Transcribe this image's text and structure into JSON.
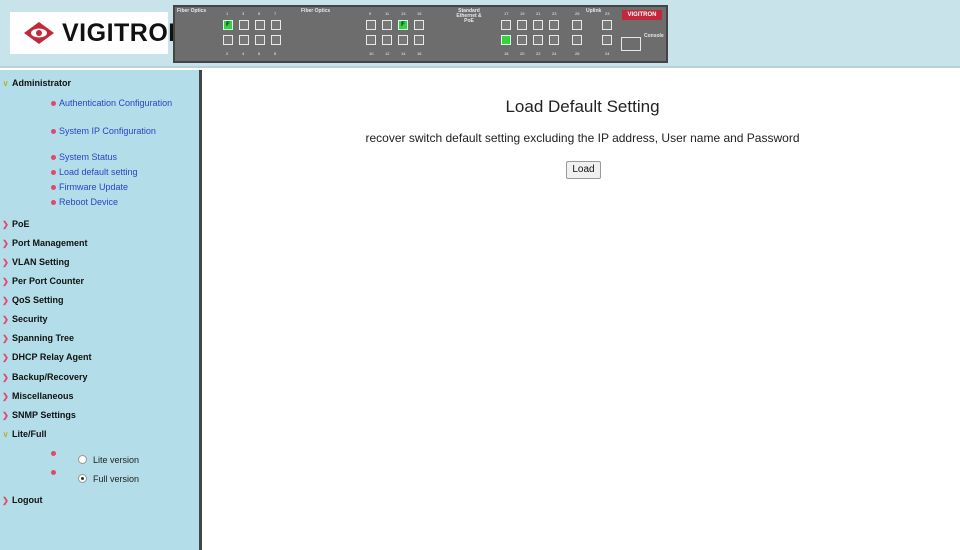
{
  "header": {
    "logo_text": "VIGITRON",
    "panel": {
      "group1_label": "Fiber Optics",
      "group2_label": "Fiber Optics",
      "group3_label": "Standard Ethernet & PoE",
      "uplink_label": "Uplink",
      "console_label": "Console",
      "panel_logo_text": "VIGITRON",
      "fiber_marker": "F",
      "top_numbers": [
        "1",
        "3",
        "5",
        "7",
        "9",
        "11",
        "13",
        "15",
        "17",
        "19",
        "21",
        "23",
        "25",
        "23"
      ],
      "bottom_numbers": [
        "2",
        "4",
        "6",
        "8",
        "10",
        "12",
        "14",
        "16",
        "18",
        "20",
        "22",
        "24",
        "26",
        "24"
      ]
    }
  },
  "sidebar": {
    "sections": [
      {
        "label": "Administrator",
        "expanded": true
      },
      {
        "label": "PoE"
      },
      {
        "label": "Port Management"
      },
      {
        "label": "VLAN Setting"
      },
      {
        "label": "Per Port Counter"
      },
      {
        "label": "QoS Setting"
      },
      {
        "label": "Security"
      },
      {
        "label": "Spanning Tree"
      },
      {
        "label": "DHCP Relay Agent"
      },
      {
        "label": "Backup/Recovery"
      },
      {
        "label": "Miscellaneous"
      },
      {
        "label": "SNMP Settings"
      },
      {
        "label": "Lite/Full",
        "expanded": true
      },
      {
        "label": "Logout"
      }
    ],
    "admin_items": [
      {
        "label": "Authentication Configuration"
      },
      {
        "label": "System IP Configuration"
      },
      {
        "label": "System Status"
      },
      {
        "label": "Load default setting"
      },
      {
        "label": "Firmware Update"
      },
      {
        "label": "Reboot Device"
      }
    ],
    "version_options": [
      {
        "label": "Lite version",
        "selected": false
      },
      {
        "label": "Full version",
        "selected": true
      }
    ]
  },
  "main": {
    "title": "Load Default Setting",
    "description": "recover switch default setting excluding the IP address, User name and Password",
    "load_button": "Load"
  },
  "colors": {
    "header_bg": "#c8e3ea",
    "sidebar_bg": "#b3dde8",
    "link": "#2a44c8",
    "bullet": "#e3476a",
    "port_active": "#38d33a"
  }
}
